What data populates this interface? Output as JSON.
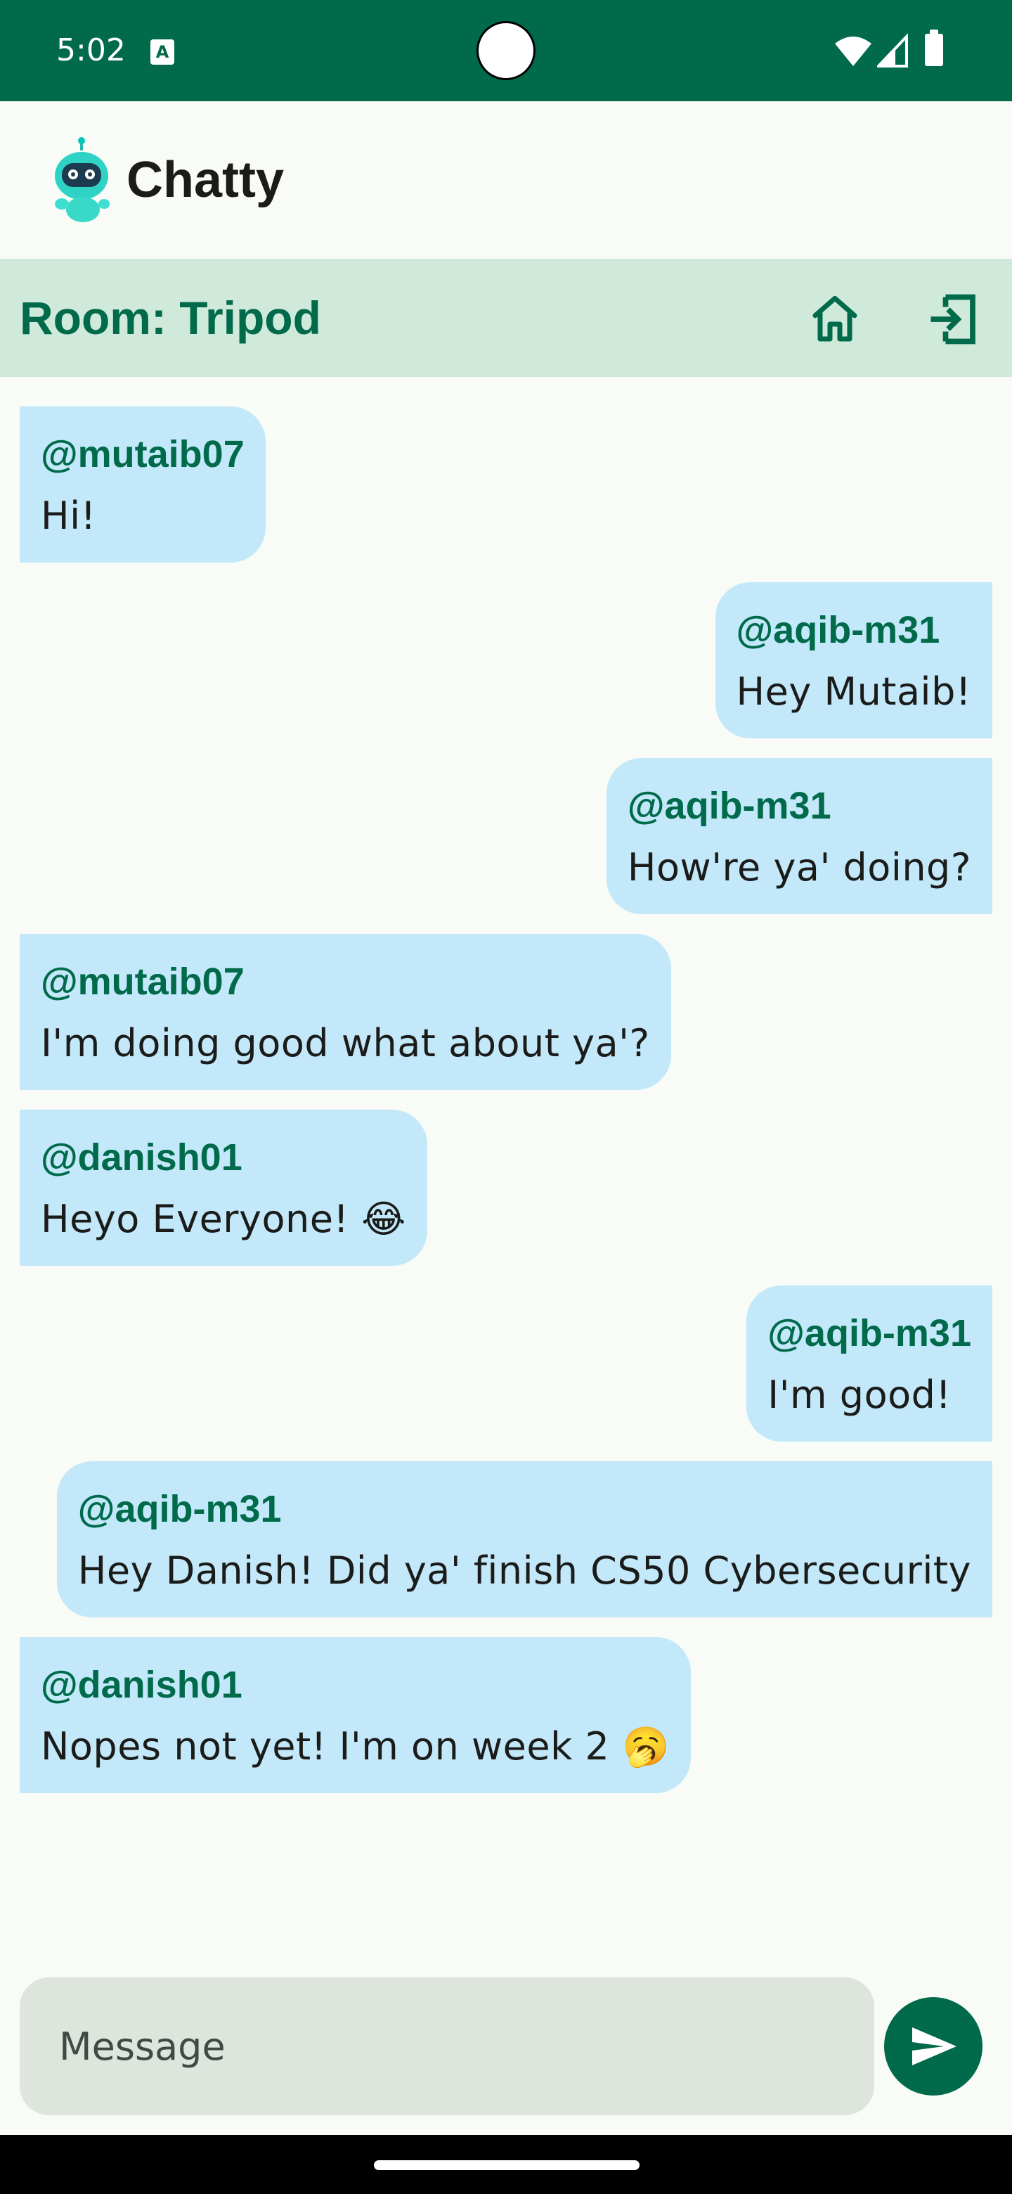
{
  "status_bar": {
    "time": "5:02",
    "notification_icon": "A",
    "icons": [
      "wifi-icon",
      "signal-icon",
      "battery-icon"
    ],
    "background": "#006a4a"
  },
  "app": {
    "name": "Chatty",
    "logo_icon": "robot-mascot-icon"
  },
  "room": {
    "title": "Room: Tripod",
    "home_icon": "home-icon",
    "exit_icon": "exit-icon",
    "background": "#cfe9da",
    "accent": "#006a4a"
  },
  "messages": [
    {
      "sender": "@mutaib07",
      "text": "Hi!",
      "side": "left"
    },
    {
      "sender": "@aqib-m31",
      "text": "Hey Mutaib!",
      "side": "right"
    },
    {
      "sender": "@aqib-m31",
      "text": "How're ya' doing?",
      "side": "right"
    },
    {
      "sender": "@mutaib07",
      "text": "I'm doing good what about ya'?",
      "side": "left"
    },
    {
      "sender": "@danish01",
      "text": "Heyo Everyone! 😂",
      "side": "left"
    },
    {
      "sender": "@aqib-m31",
      "text": "I'm good!",
      "side": "right"
    },
    {
      "sender": "@aqib-m31",
      "text": "Hey Danish! Did ya' finish CS50 Cybersecurity",
      "side": "right"
    },
    {
      "sender": "@danish01",
      "text": "Nopes not yet! I'm on week 2 🥱",
      "side": "left"
    }
  ],
  "bubble_color": "#c2e8f9",
  "input": {
    "placeholder": "Message",
    "value": ""
  },
  "send_icon": "send-icon"
}
